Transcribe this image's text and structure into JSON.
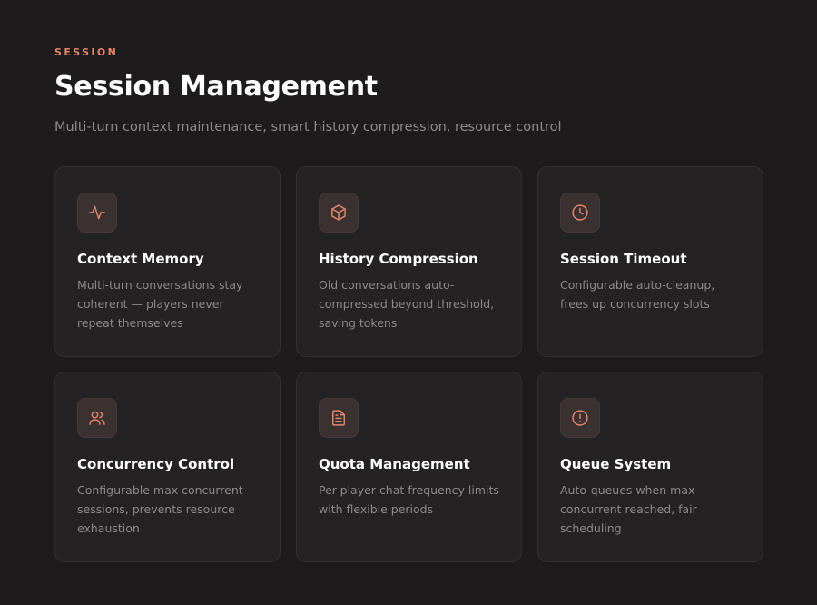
{
  "header": {
    "eyebrow": "SESSION",
    "title": "Session Management",
    "subtitle": "Multi-turn context maintenance, smart history compression, resource control"
  },
  "colors": {
    "accent": "#e5836a",
    "background": "#1d1b1c",
    "card": "#242223"
  },
  "cards": [
    {
      "icon": "activity-icon",
      "title": "Context Memory",
      "desc": "Multi-turn conversations stay coherent — players never repeat themselves"
    },
    {
      "icon": "cube-icon",
      "title": "History Compression",
      "desc": "Old conversations auto-compressed beyond threshold, saving tokens"
    },
    {
      "icon": "clock-icon",
      "title": "Session Timeout",
      "desc": "Configurable auto-cleanup, frees up concurrency slots"
    },
    {
      "icon": "users-icon",
      "title": "Concurrency Control",
      "desc": "Configurable max concurrent sessions, prevents resource exhaustion"
    },
    {
      "icon": "document-icon",
      "title": "Quota Management",
      "desc": "Per-player chat frequency limits with flexible periods"
    },
    {
      "icon": "alert-circle-icon",
      "title": "Queue System",
      "desc": "Auto-queues when max concurrent reached, fair scheduling"
    }
  ]
}
